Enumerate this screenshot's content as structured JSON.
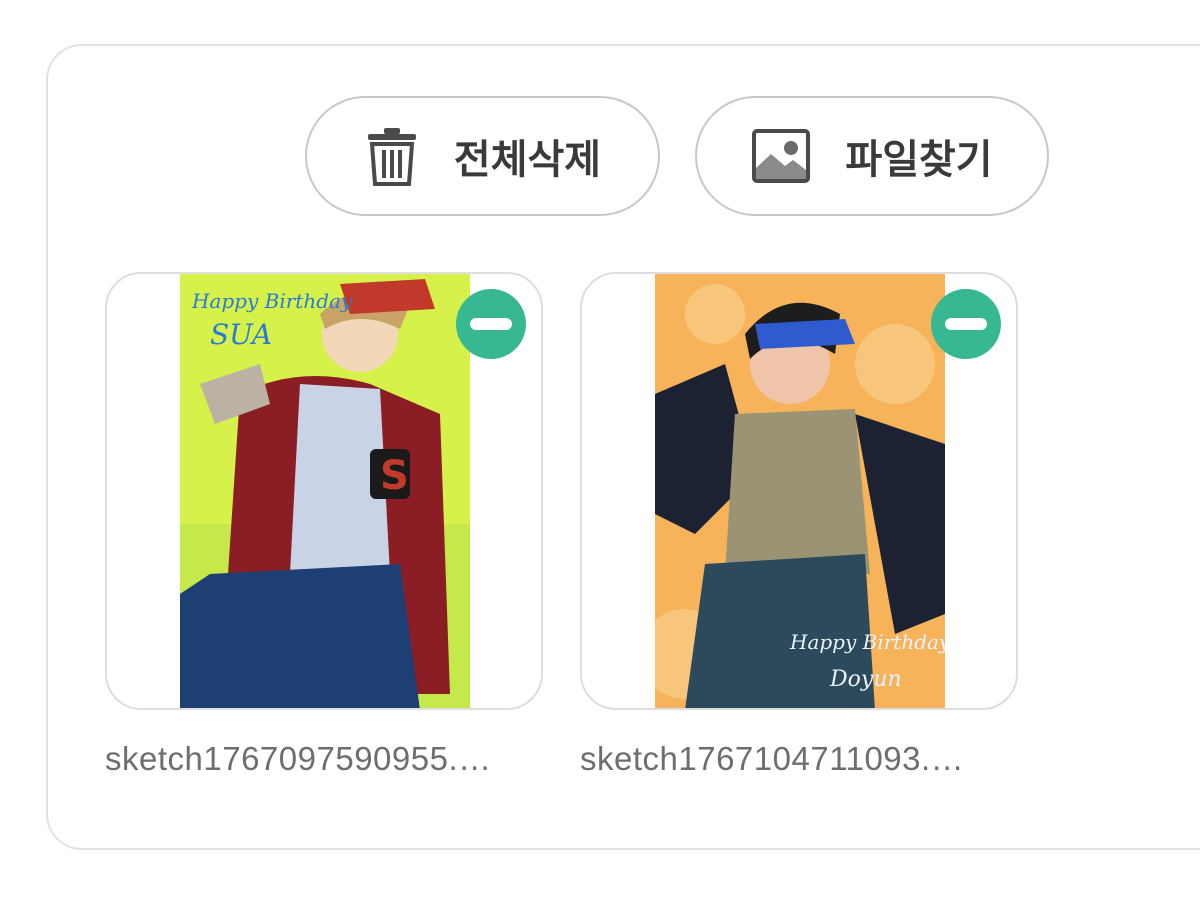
{
  "toolbar": {
    "delete_all_label": "전체삭제",
    "find_file_label": "파일찾기",
    "delete_icon": "trash-icon",
    "find_icon": "image-icon"
  },
  "attachments": [
    {
      "filename": "sketch1767097590955.…",
      "art_text_line1": "Happy Birthday",
      "art_text_line2": "SUA",
      "art_letter": "S",
      "remove_icon": "minus-circle-icon",
      "background": "#d6f24a"
    },
    {
      "filename": "sketch1767104711093.…",
      "art_text_line1": "Happy Birthday",
      "art_text_line2": "Doyun",
      "remove_icon": "minus-circle-icon",
      "background": "#f6b35a"
    }
  ],
  "colors": {
    "accent": "#37b893",
    "border": "#c8c8c8",
    "text": "#3a3a3a",
    "filename": "#6e6e6e"
  }
}
